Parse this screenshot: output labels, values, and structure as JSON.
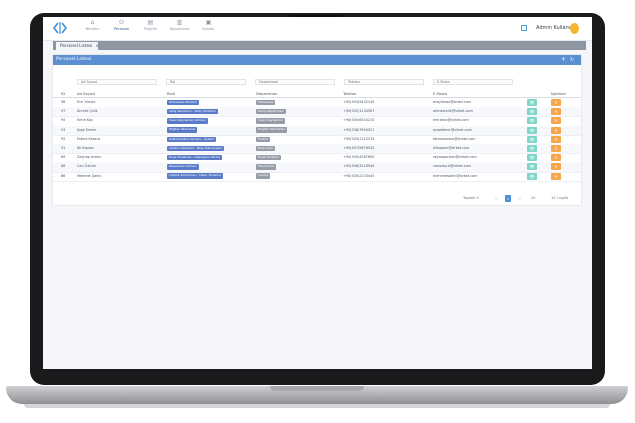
{
  "colors": {
    "accent": "#5b8fd1",
    "view_button": "#7fd6c6",
    "edit_button": "#f7a64a",
    "avatar": "#f5b731"
  },
  "nav": [
    {
      "label": "Yönetim",
      "icon": "home-icon"
    },
    {
      "label": "Personel",
      "icon": "user-icon"
    },
    {
      "label": "Projeler",
      "icon": "folder-icon"
    },
    {
      "label": "Raporlama",
      "icon": "chart-icon"
    },
    {
      "label": "Ayarlar",
      "icon": "settings-icon"
    }
  ],
  "user": {
    "name": "Admin Kullanıcı"
  },
  "tabs": [
    {
      "label": "Personel Listesi",
      "close": "×"
    }
  ],
  "card": {
    "title": "Personel Listesi",
    "add_icon": "+",
    "refresh_icon": "↻"
  },
  "filters": [
    "Ad Soyad",
    "Rol",
    "Departman",
    "Telefon",
    "E-Posta"
  ],
  "table": {
    "headers": [
      "ID",
      "Ad Soyad",
      "Rolü",
      "Departman",
      "Telefon",
      "E-Posta",
      "",
      "İşlemler"
    ],
    "rows": [
      {
        "id": "98",
        "name": "Ece Yılmaz",
        "role": "Muhasebe Müdürü",
        "dept": "Muhasebe",
        "phone": "+90(544)5432145",
        "email": "eceyilmaz@sirket.com"
      },
      {
        "id": "97",
        "name": "Ahmet Çelik",
        "role": "Satış Temsilcisi - Satış Yönetimi",
        "dept": "Satış Departmanı",
        "phone": "+90(532)1234567",
        "email": "ahmetcelik@sirket.com"
      },
      {
        "id": "95",
        "name": "Emre Koç",
        "role": "İnsan Kaynakları Uzmanı",
        "dept": "İnsan Kaynakları",
        "phone": "+90(555)6543210",
        "email": "emrekoc@sirket.com"
      },
      {
        "id": "93",
        "name": "Ayşe Demir",
        "role": "Müşteri Temsilcisi",
        "dept": "Müşteri Hizmetleri",
        "phone": "+90(538)7654321",
        "email": "aysedemir@sirket.com"
      },
      {
        "id": "92",
        "name": "Fatma Karaca",
        "role": "Kalite Kontrol Uzmanı - Üretim",
        "dept": "Üretim",
        "phone": "+90(543)1112233",
        "email": "fatmakaraca@sirket.com"
      },
      {
        "id": "91",
        "name": "Ali Kaplan",
        "role": "Yazılım Geliştirici - Bilgi Teknolojileri",
        "dept": "Bilgi İşlem",
        "phone": "+90(507)9876543",
        "email": "alikaplan@sirket.com"
      },
      {
        "id": "89",
        "name": "Zeynep Arslan",
        "role": "Proje Yöneticisi - Operasyon Birimi",
        "dept": "Proje Yönetimi",
        "phone": "+90(505)4567890",
        "email": "zeyneparslan@sirket.com"
      },
      {
        "id": "88",
        "name": "Can Öztürk",
        "role": "Pazarlama Uzmanı",
        "dept": "Pazarlama",
        "phone": "+90(546)3216549",
        "email": "canozturk@sirket.com"
      },
      {
        "id": "86",
        "name": "Mehmet Şahin",
        "role": "Lojistik Sorumlusu - Depo Yönetimi",
        "dept": "Lojistik",
        "phone": "+90(530)2233445",
        "email": "mehmetsahin@sirket.com"
      }
    ]
  },
  "row_actions": {
    "view_icon": "👁",
    "edit_icon": "✎"
  },
  "pagination": {
    "info": "Toplam 9",
    "prev": "‹",
    "current": "1",
    "next": "›",
    "page_size": "10 / sayfa",
    "page_size_short": "20"
  }
}
